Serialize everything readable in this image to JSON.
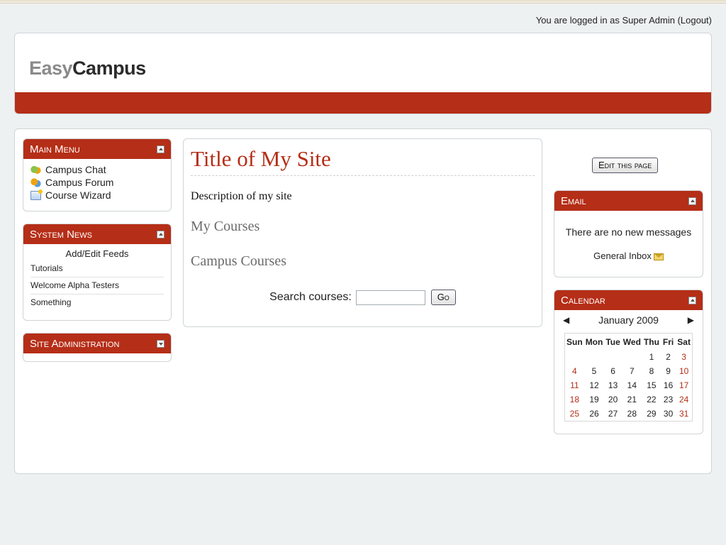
{
  "login": {
    "prefix": "You are logged in as",
    "user": "Super Admin",
    "logout": "(Logout)"
  },
  "logo": {
    "part1": "Easy",
    "part2": "Campus"
  },
  "main_menu": {
    "title": "Main Menu",
    "items": [
      {
        "label": "Campus Chat",
        "icon": "chat-icon"
      },
      {
        "label": "Campus Forum",
        "icon": "forum-icon"
      },
      {
        "label": "Course Wizard",
        "icon": "wizard-icon"
      }
    ]
  },
  "system_news": {
    "title": "System News",
    "edit_feeds": "Add/Edit Feeds",
    "items": [
      "Tutorials",
      "Welcome Alpha Testers",
      "Something"
    ]
  },
  "site_admin": {
    "title": "Site Administration"
  },
  "main": {
    "title": "Title of My Site",
    "description": "Description of my site",
    "my_courses": "My Courses",
    "campus_courses": "Campus Courses",
    "search_label": "Search courses:",
    "search_value": "",
    "go": "Go"
  },
  "edit_page": "Edit this page",
  "email": {
    "title": "Email",
    "message": "There are no new messages",
    "inbox": "General Inbox"
  },
  "calendar": {
    "title": "Calendar",
    "month": "January 2009",
    "prev": "◀",
    "next": "▶",
    "days": [
      "Sun",
      "Mon",
      "Tue",
      "Wed",
      "Thu",
      "Fri",
      "Sat"
    ],
    "weeks": [
      [
        "",
        "",
        "",
        "",
        "1",
        "2",
        "3"
      ],
      [
        "4",
        "5",
        "6",
        "7",
        "8",
        "9",
        "10"
      ],
      [
        "11",
        "12",
        "13",
        "14",
        "15",
        "16",
        "17"
      ],
      [
        "18",
        "19",
        "20",
        "21",
        "22",
        "23",
        "24"
      ],
      [
        "25",
        "26",
        "27",
        "28",
        "29",
        "30",
        "31"
      ]
    ]
  },
  "colors": {
    "accent": "#b52e17",
    "background": "#eef1f2",
    "heading_grey": "#6b6b6b"
  }
}
